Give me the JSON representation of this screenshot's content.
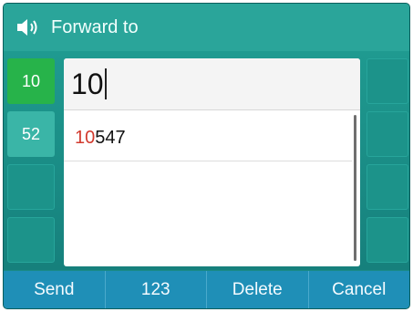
{
  "title_bar": {
    "icon": "speaker-icon",
    "title": "Forward to"
  },
  "line_keys": [
    {
      "label": "10",
      "active": true
    },
    {
      "label": "52",
      "active": false
    }
  ],
  "input": {
    "value": "10"
  },
  "results": [
    {
      "match": "10",
      "rest": "547"
    }
  ],
  "softkeys": {
    "send": "Send",
    "mode": "123",
    "delete": "Delete",
    "cancel": "Cancel"
  },
  "colors": {
    "title_bar": "#2aa59a",
    "background": "#1a8a86",
    "active_key": "#27b34a",
    "softkey_bar": "#1f8fb7",
    "match_highlight": "#d23a2e"
  }
}
